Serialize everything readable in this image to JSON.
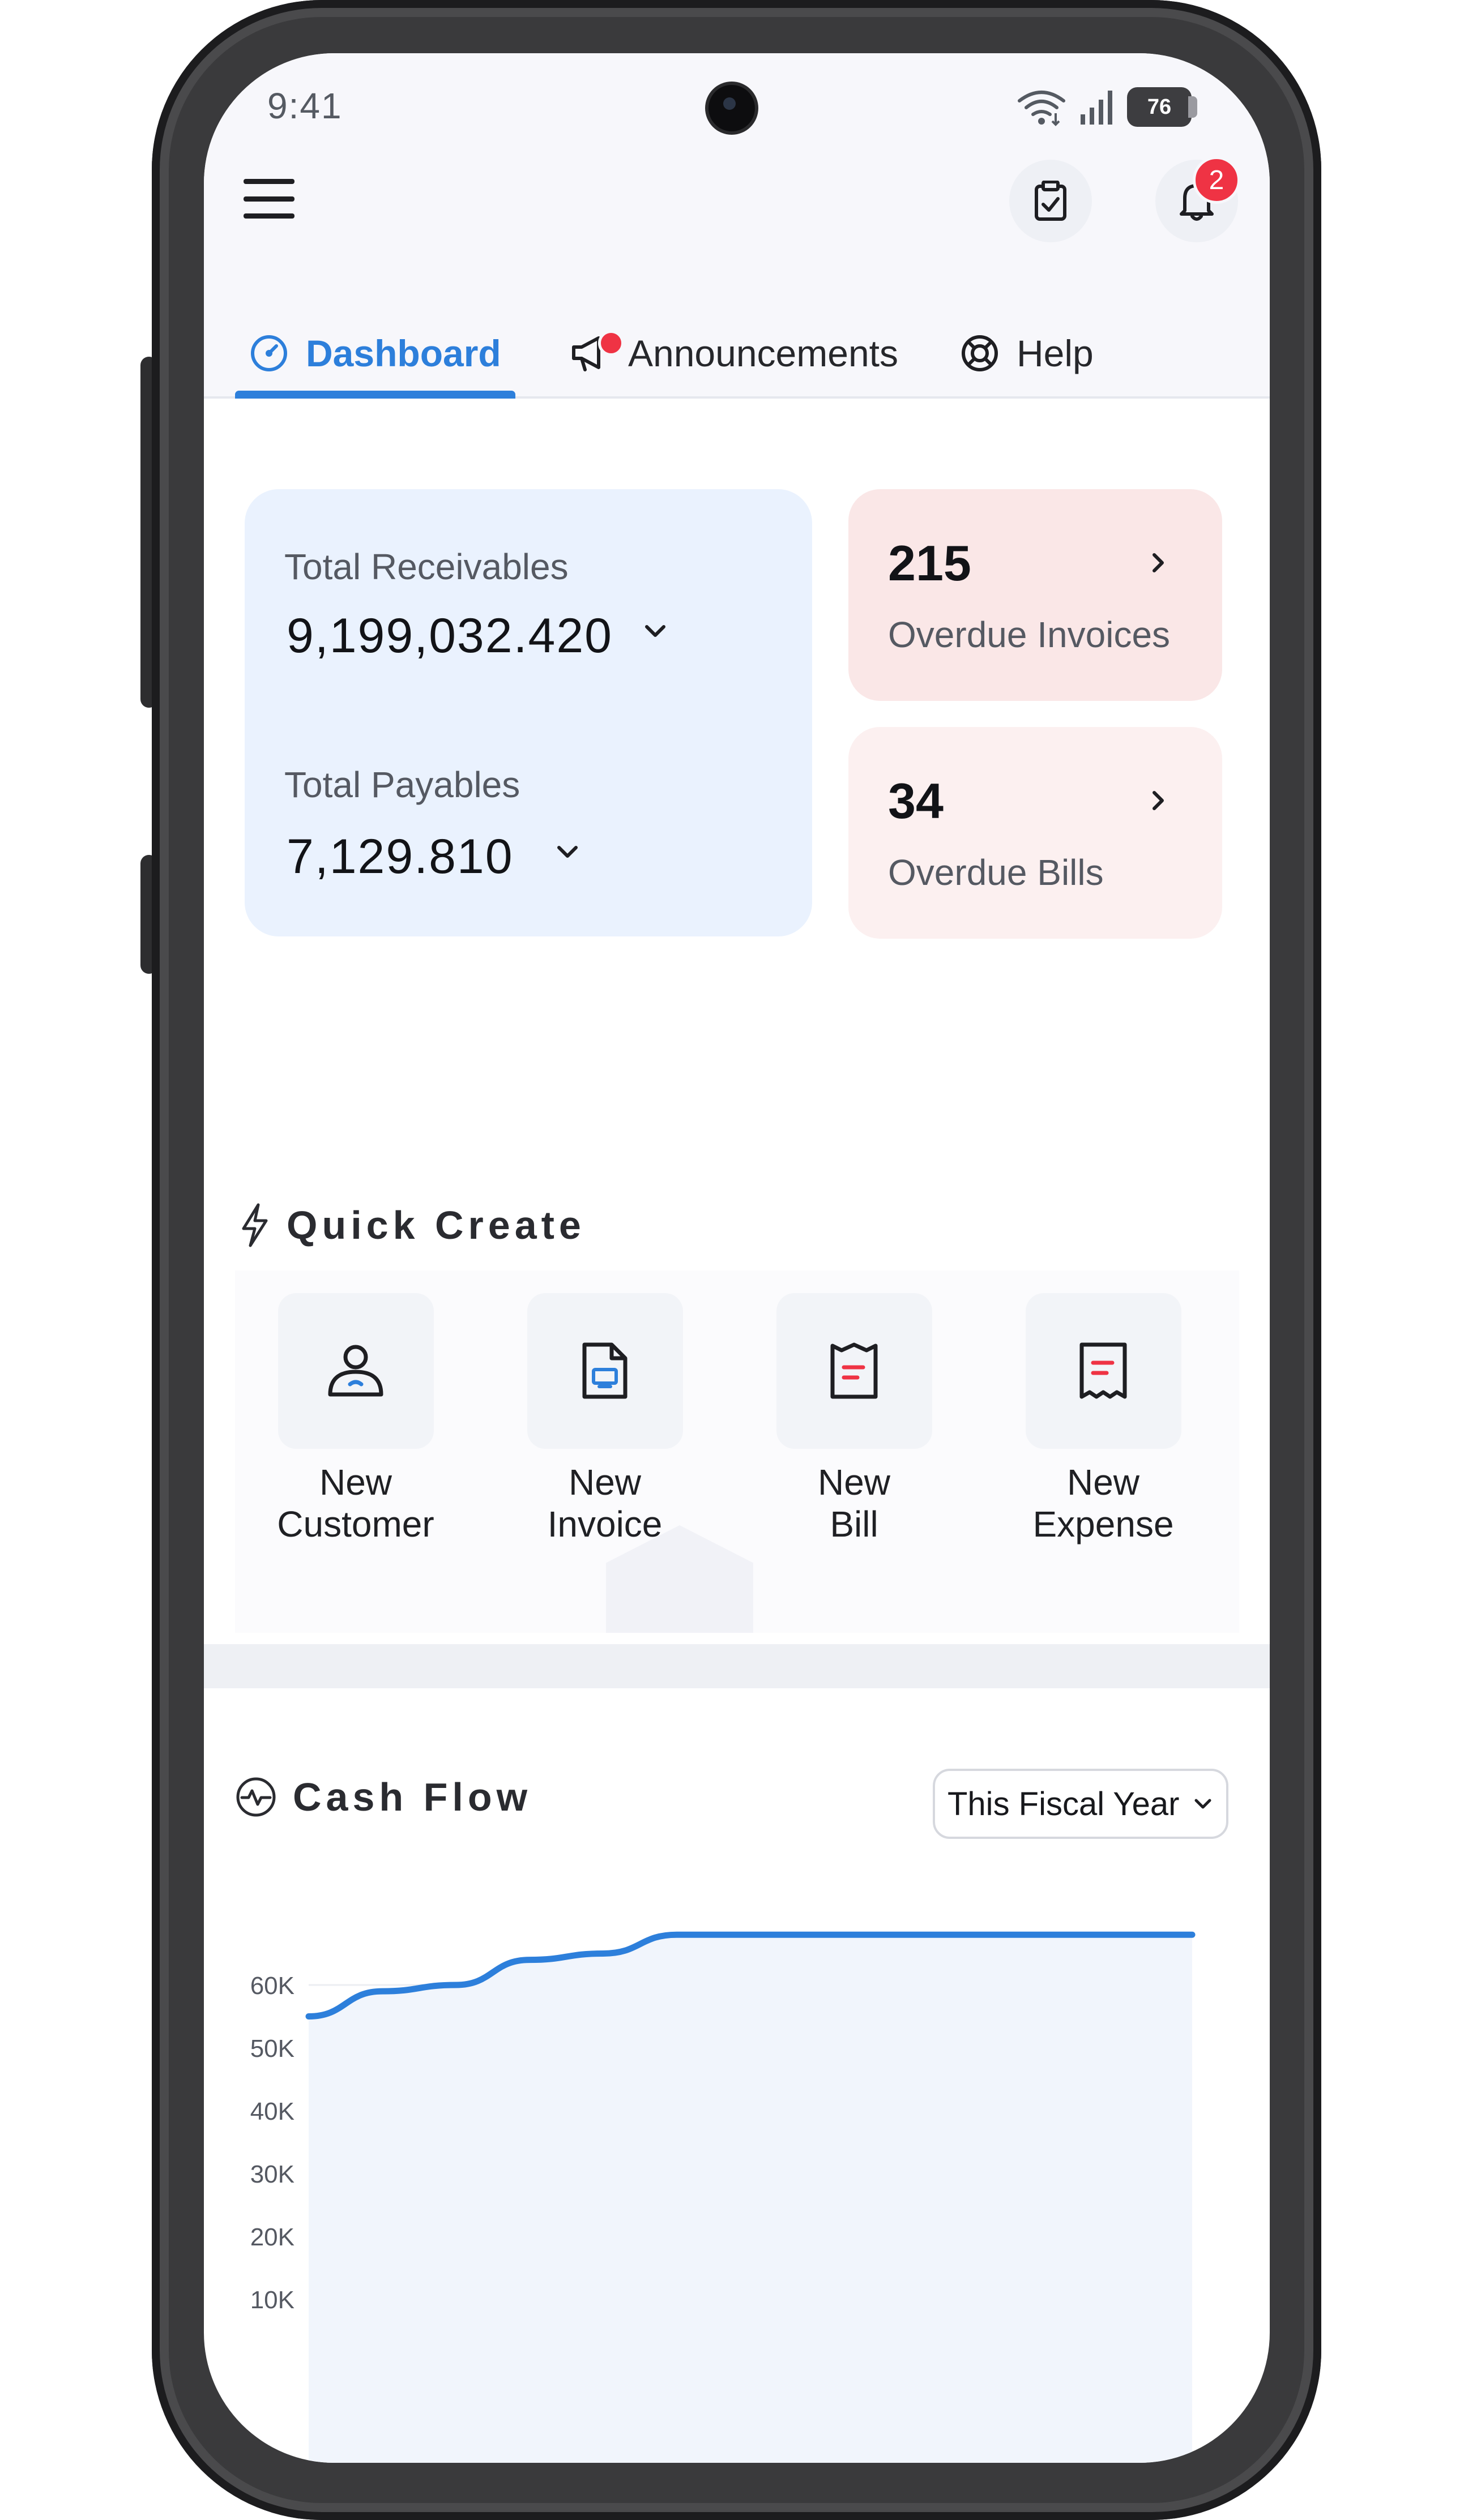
{
  "status": {
    "time": "9:41",
    "battery": "76"
  },
  "header": {
    "notification_count": "2"
  },
  "tabs": [
    {
      "label": "Dashboard",
      "active": true
    },
    {
      "label": "Announcements",
      "has_dot": true
    },
    {
      "label": "Help"
    }
  ],
  "summary": {
    "receivables_label": "Total Receivables",
    "receivables_value": "9,199,032.420",
    "payables_label": "Total Payables",
    "payables_value": "7,129.810",
    "overdue_invoices_count": "215",
    "overdue_invoices_label": "Overdue Invoices",
    "overdue_bills_count": "34",
    "overdue_bills_label": "Overdue Bills"
  },
  "quick_create": {
    "title": "Quick Create",
    "items": [
      {
        "line1": "New",
        "line2": "Customer",
        "icon": "customer-icon"
      },
      {
        "line1": "New",
        "line2": "Invoice",
        "icon": "invoice-icon"
      },
      {
        "line1": "New",
        "line2": "Bill",
        "icon": "bill-icon"
      },
      {
        "line1": "New",
        "line2": "Expense",
        "icon": "expense-icon"
      }
    ]
  },
  "cash_flow": {
    "title": "Cash Flow",
    "period": "This Fiscal Year"
  },
  "colors": {
    "accent": "#2d7fdb",
    "alert": "#ef3344",
    "receivables_bg": "#eaf2fe",
    "overdue_invoices_bg": "#fae7e7",
    "overdue_bills_bg": "#fcf0f0"
  },
  "chart_data": {
    "type": "area",
    "yticks": [
      "60K",
      "50K",
      "40K",
      "30K",
      "20K",
      "10K"
    ],
    "ylim": [
      0,
      70000
    ],
    "x": [
      0,
      1,
      2,
      3,
      4,
      5,
      6,
      7,
      8,
      9,
      10,
      11
    ],
    "values": [
      55000,
      59000,
      60000,
      64000,
      65000,
      68000,
      68000,
      68000,
      68000,
      68000,
      68000,
      68000
    ]
  }
}
